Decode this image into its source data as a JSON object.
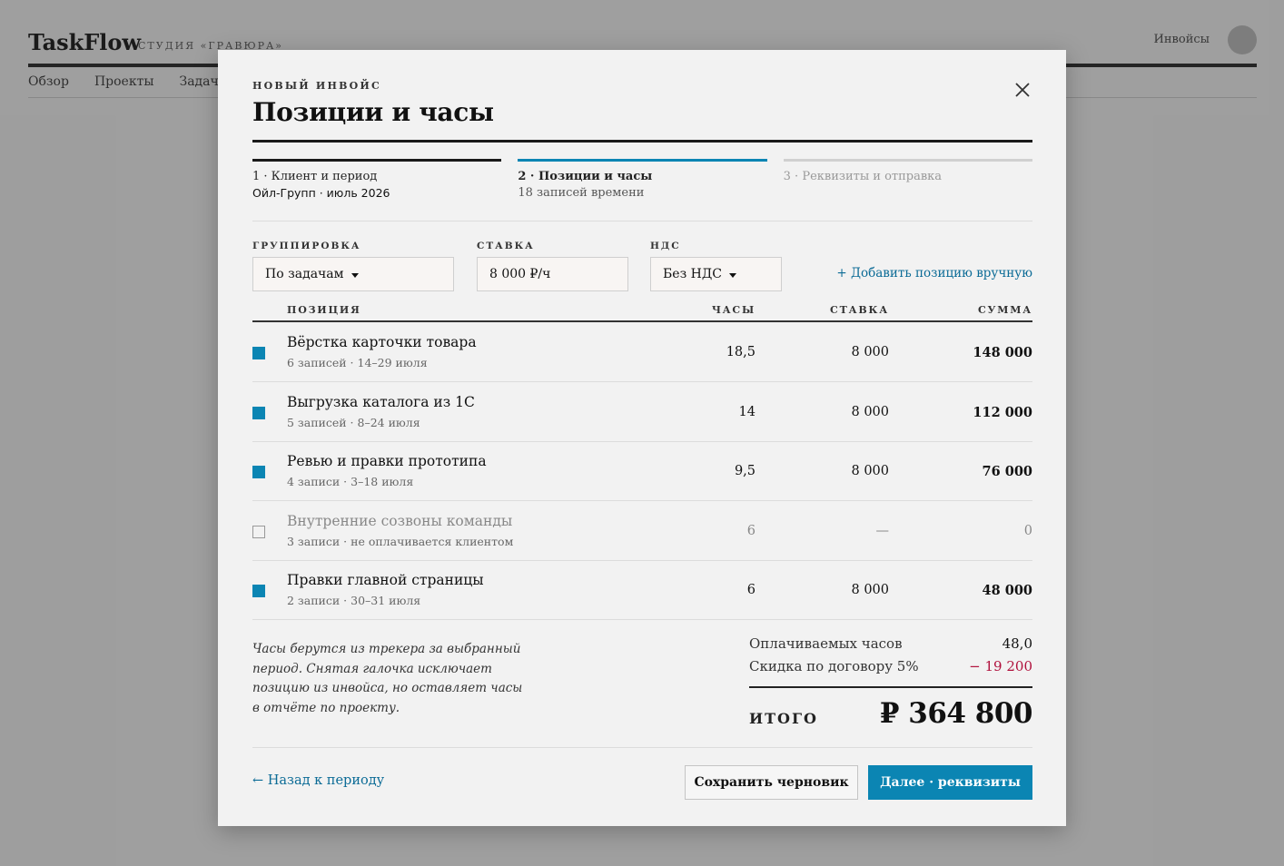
{
  "app": {
    "brand": "TaskFlow",
    "studio": "СТУДИЯ «ГРАВЮРА»",
    "right_link": "Инвойсы",
    "nav": [
      "Обзор",
      "Проекты",
      "Задачи"
    ]
  },
  "modal": {
    "kicker": "НОВЫЙ ИНВОЙС",
    "title": "Позиции и часы",
    "steps": [
      {
        "title": "1 · Клиент и период",
        "sub": "Ойл-Групп · июль 2026",
        "state": "done"
      },
      {
        "title": "2 · Позиции и часы",
        "sub": "18 записей времени",
        "state": "active"
      },
      {
        "title": "3 · Реквизиты и отправка",
        "sub": "",
        "state": "todo"
      }
    ],
    "filters": {
      "grouping": {
        "label": "ГРУППИРОВКА",
        "value": "По задачам"
      },
      "rate": {
        "label": "СТАВКА",
        "value": "8 000 ₽/ч"
      },
      "vat": {
        "label": "НДС",
        "value": "Без НДС"
      },
      "add_link": "+ Добавить позицию вручную"
    },
    "table": {
      "headers": {
        "position": "ПОЗИЦИЯ",
        "hours": "ЧАСЫ",
        "rate": "СТАВКА",
        "sum": "СУММА"
      },
      "rows": [
        {
          "name": "Вёрстка карточки товара",
          "meta": "6 записей · 14–29 июля",
          "hours": "18,5",
          "rate": "8 000",
          "sum": "148 000",
          "checked": true
        },
        {
          "name": "Выгрузка каталога из 1С",
          "meta": "5 записей · 8–24 июля",
          "hours": "14",
          "rate": "8 000",
          "sum": "112 000",
          "checked": true
        },
        {
          "name": "Ревью и правки прототипа",
          "meta": "4 записи · 3–18 июля",
          "hours": "9,5",
          "rate": "8 000",
          "sum": "76 000",
          "checked": true
        },
        {
          "name": "Внутренние созвоны команды",
          "meta": "3 записи · не оплачивается клиентом",
          "hours": "6",
          "rate": "—",
          "sum": "0",
          "checked": false
        },
        {
          "name": "Правки главной страницы",
          "meta": "2 записи · 30–31 июля",
          "hours": "6",
          "rate": "8 000",
          "sum": "48 000",
          "checked": true
        }
      ]
    },
    "note": "Часы берутся из трекера за выбранный период. Снятая галочка исключает позицию из инвойса, но оставляет часы в отчёте по проекту.",
    "totals": {
      "billable_label": "Оплачиваемых часов",
      "billable_value": "48,0",
      "discount_label": "Скидка по договору 5%",
      "discount_value": "− 19 200",
      "total_label": "ИТОГО",
      "total_value": "₽ 364 800"
    },
    "footer": {
      "back": "← Назад к периоду",
      "save": "Сохранить черновик",
      "next": "Далее · реквизиты"
    },
    "colors": {
      "accent": "#0b85b3",
      "negative": "#b0103c"
    }
  }
}
